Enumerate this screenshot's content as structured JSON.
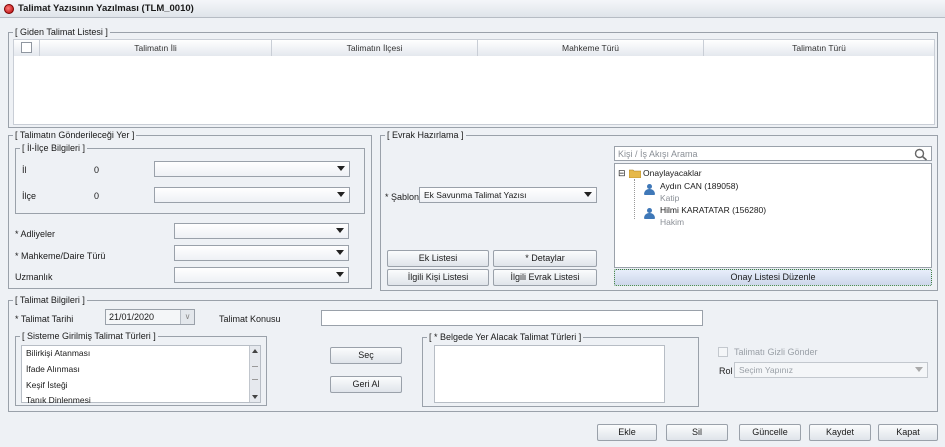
{
  "window": {
    "title": "Talimat Yazısının Yazılması (TLM_0010)"
  },
  "giden": {
    "legend": "[ Giden Talimat Listesi ]",
    "columns": [
      "Talimatın İli",
      "Talimatın İlçesi",
      "Mahkeme Türü",
      "Talimatın Türü"
    ]
  },
  "gonderilecek": {
    "legend": "[ Talimatın Gönderileceği Yer ]",
    "ilce_legend": "[ İl-İlçe Bilgileri ]",
    "il_label": "İl",
    "il_code": "0",
    "ilce_label": "İlçe",
    "ilce_code": "0",
    "adliyeler_label": "* Adliyeler",
    "mahkeme_label": "* Mahkeme/Daire Türü",
    "uzmanlik_label": "Uzmanlık"
  },
  "evrak": {
    "legend": "[ Evrak Hazırlama ]",
    "sablon_label": "* Şablon",
    "sablon_value": "Ek Savunma Talimat Yazısı",
    "ek_listesi": "Ek Listesi",
    "detaylar": "* Detaylar",
    "ilgili_kisi": "İlgili Kişi Listesi",
    "ilgili_evrak": "İlgili Evrak Listesi",
    "search_placeholder": "Kişi / İş Akışı Arama",
    "tree_root": "Onaylayacaklar",
    "person1_name": "Aydın CAN (189058)",
    "person1_role": "Katip",
    "person2_name": "Hilmi KARATATAR (156280)",
    "person2_role": "Hakim",
    "onay_button": "Onay Listesi Düzenle"
  },
  "bilgiler": {
    "legend": "[ Talimat Bilgileri ]",
    "tarih_label": "* Talimat Tarihi",
    "tarih_value": "21/01/2020",
    "konusu_label": "Talimat Konusu",
    "sistem_legend": "[ Sisteme Girilmiş Talimat Türleri ]",
    "sistem_items": [
      "Bilirkişi Atanması",
      "İfade Alınması",
      "Keşif İsteği",
      "Tanık Dinlenmesi"
    ],
    "sec_button": "Seç",
    "geri_button": "Geri Al",
    "belge_legend": "[ * Belgede Yer Alacak Talimat Türleri ]",
    "gizli_label": "Talimatı Gizli Gönder",
    "rol_label": "Rol",
    "rol_placeholder": "Seçim Yapınız"
  },
  "footer": {
    "ekle": "Ekle",
    "sil": "Sil",
    "guncelle": "Güncelle",
    "kaydet": "Kaydet",
    "kapat": "Kapat"
  }
}
